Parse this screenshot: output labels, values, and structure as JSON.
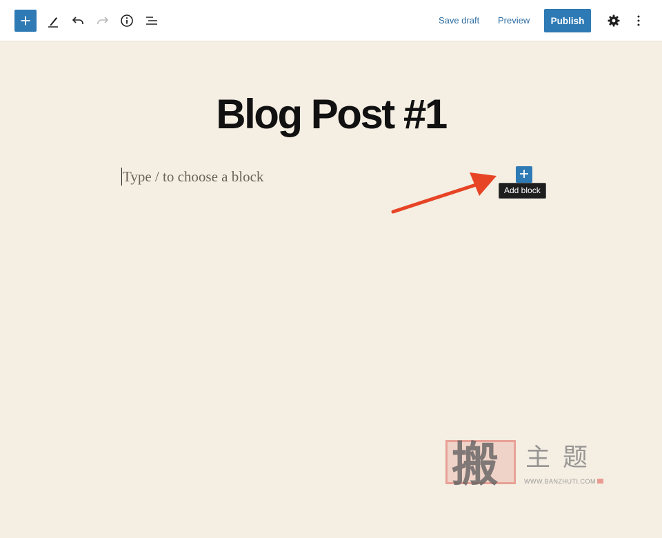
{
  "toolbar": {
    "inserter_icon": "plus-icon",
    "tools_icon": "pencil-icon",
    "undo_icon": "undo-icon",
    "redo_icon": "redo-icon",
    "details_icon": "info-icon",
    "outline_icon": "list-view-icon",
    "save_draft_label": "Save draft",
    "preview_label": "Preview",
    "publish_label": "Publish",
    "settings_icon": "gear-icon",
    "options_icon": "more-vertical-icon",
    "accent_color": "#2e7ab5",
    "link_color": "#2e6ea3"
  },
  "editor": {
    "post_title": "Blog Post #1",
    "block_placeholder": "Type / to choose a block",
    "add_block_icon": "plus-icon",
    "add_block_tooltip": "Add block",
    "background_color": "#f4eee3",
    "annotation": "red-arrow-pointing-to-add-block"
  },
  "watermark": {
    "seal_char": "搬",
    "chars": "主题",
    "url": "WWW.BANZHUTI.COM"
  }
}
